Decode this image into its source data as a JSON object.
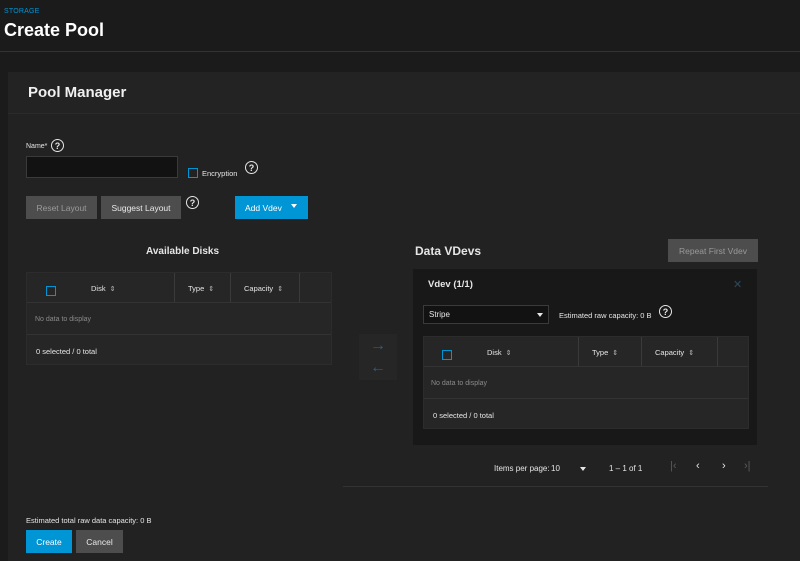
{
  "header": {
    "breadcrumb": "STORAGE",
    "title": "Create Pool"
  },
  "card": {
    "title": "Pool Manager"
  },
  "form": {
    "name_label": "Name*",
    "name_value": "",
    "encryption_label": "Encryption",
    "help_glyph": "?"
  },
  "buttons": {
    "reset_layout": "Reset Layout",
    "suggest_layout": "Suggest Layout",
    "add_vdev": "Add Vdev",
    "repeat_first_vdev": "Repeat First Vdev",
    "create": "Create",
    "cancel": "Cancel"
  },
  "available_disks": {
    "title": "Available Disks",
    "columns": [
      "Disk",
      "Type",
      "Capacity"
    ],
    "empty_text": "No data to display",
    "footer": "0 selected / 0 total"
  },
  "data_vdevs": {
    "title": "Data VDevs",
    "vdev_title": "Vdev (1/1)",
    "layout_selected": "Stripe",
    "estimated_capacity": "Estimated raw capacity: 0 B",
    "columns": [
      "Disk",
      "Type",
      "Capacity"
    ],
    "empty_text": "No data to display",
    "footer": "0 selected / 0 total"
  },
  "pagination": {
    "items_per_page_label": "Items per page:",
    "items_per_page_value": "10",
    "range": "1 – 1 of 1"
  },
  "footer": {
    "estimated_total": "Estimated total raw data capacity: 0 B"
  },
  "colors": {
    "accent": "#0095d5",
    "background": "#1b1b1b",
    "card": "#222222"
  },
  "icons": [
    "help-icon",
    "sort-icon",
    "dropdown-arrow-icon",
    "arrow-right-icon",
    "arrow-left-icon",
    "close-icon",
    "first-page-icon",
    "prev-page-icon",
    "next-page-icon",
    "last-page-icon"
  ]
}
